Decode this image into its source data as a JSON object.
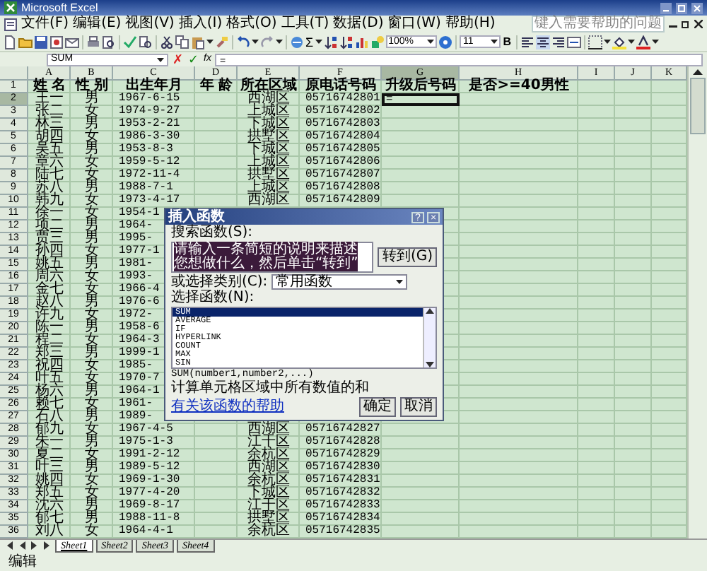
{
  "window": {
    "title": "Microsoft Excel"
  },
  "menu": [
    "文件(F)",
    "编辑(E)",
    "视图(V)",
    "插入(I)",
    "格式(O)",
    "工具(T)",
    "数据(D)",
    "窗口(W)",
    "帮助(H)"
  ],
  "help_box": {
    "placeholder": "键入需要帮助的问题"
  },
  "toolbar": {
    "sum": "Σ",
    "zoom": "100%",
    "font_size": "11",
    "bold": "B"
  },
  "formula_bar": {
    "name_box": "SUM",
    "cancel": "✗",
    "enter": "✓",
    "function": "fx",
    "content": "="
  },
  "columns": [
    {
      "label": "A",
      "selected": false
    },
    {
      "label": "B",
      "selected": false
    },
    {
      "label": "C",
      "selected": false
    },
    {
      "label": "D",
      "selected": false
    },
    {
      "label": "E",
      "selected": false
    },
    {
      "label": "F",
      "selected": false
    },
    {
      "label": "G",
      "selected": true
    },
    {
      "label": "H",
      "selected": false
    },
    {
      "label": "I",
      "selected": false
    },
    {
      "label": "J",
      "selected": false
    },
    {
      "label": "K",
      "selected": false
    }
  ],
  "header_row": {
    "number": "1",
    "name": "姓 名",
    "sex": "性 别",
    "birth": "出生年月",
    "age": "年 龄",
    "district": "所在区域",
    "phone": "原电话号码",
    "new_phone": "升级后号码",
    "male_over_40": "是否>=40男性"
  },
  "rows": [
    {
      "number": "2",
      "name": "王一",
      "sex": "男",
      "birth": "1967-6-15",
      "district": "西湖区",
      "phone": "05716742801",
      "new_phone": "=",
      "active": true
    },
    {
      "number": "3",
      "name": "张二",
      "sex": "女",
      "birth": "1974-9-27",
      "district": "上城区",
      "phone": "05716742802",
      "active": false
    },
    {
      "number": "4",
      "name": "林三",
      "sex": "男",
      "birth": "1953-2-21",
      "district": "下城区",
      "phone": "05716742803",
      "active": false
    },
    {
      "number": "5",
      "name": "胡四",
      "sex": "女",
      "birth": "1986-3-30",
      "district": "拱墅区",
      "phone": "05716742804",
      "active": false
    },
    {
      "number": "6",
      "name": "吴五",
      "sex": "男",
      "birth": "1953-8-3",
      "district": "下城区",
      "phone": "05716742805",
      "active": false
    },
    {
      "number": "7",
      "name": "章六",
      "sex": "女",
      "birth": "1959-5-12",
      "district": "上城区",
      "phone": "05716742806",
      "active": false
    },
    {
      "number": "8",
      "name": "陆七",
      "sex": "女",
      "birth": "1972-11-4",
      "district": "拱墅区",
      "phone": "05716742807",
      "active": false
    },
    {
      "number": "9",
      "name": "苏八",
      "sex": "男",
      "birth": "1988-7-1",
      "district": "上城区",
      "phone": "05716742808",
      "active": false
    },
    {
      "number": "10",
      "name": "韩九",
      "sex": "女",
      "birth": "1973-4-17",
      "district": "西湖区",
      "phone": "05716742809",
      "active": false
    },
    {
      "number": "11",
      "name": "徐一",
      "sex": "女",
      "birth": "1954-1",
      "active": false
    },
    {
      "number": "12",
      "name": "项二",
      "sex": "男",
      "birth": "1964-",
      "active": false
    },
    {
      "number": "13",
      "name": "贾三",
      "sex": "男",
      "birth": "1995-",
      "active": false
    },
    {
      "number": "14",
      "name": "孙四",
      "sex": "女",
      "birth": "1977-1",
      "active": false
    },
    {
      "number": "15",
      "name": "姚五",
      "sex": "男",
      "birth": "1981-",
      "active": false
    },
    {
      "number": "16",
      "name": "周六",
      "sex": "女",
      "birth": "1993-",
      "active": false
    },
    {
      "number": "17",
      "name": "金七",
      "sex": "女",
      "birth": "1966-4",
      "active": false
    },
    {
      "number": "18",
      "name": "赵八",
      "sex": "男",
      "birth": "1976-6",
      "active": false
    },
    {
      "number": "19",
      "name": "许九",
      "sex": "女",
      "birth": "1972-",
      "active": false
    },
    {
      "number": "20",
      "name": "陈一",
      "sex": "男",
      "birth": "1958-6",
      "active": false
    },
    {
      "number": "21",
      "name": "程二",
      "sex": "女",
      "birth": "1964-3",
      "active": false
    },
    {
      "number": "22",
      "name": "郑三",
      "sex": "男",
      "birth": "1999-1",
      "active": false
    },
    {
      "number": "23",
      "name": "祝四",
      "sex": "女",
      "birth": "1985-",
      "active": false
    },
    {
      "number": "24",
      "name": "叶五",
      "sex": "女",
      "birth": "1970-7",
      "active": false
    },
    {
      "number": "25",
      "name": "杨六",
      "sex": "男",
      "birth": "1964-1",
      "active": false
    },
    {
      "number": "26",
      "name": "赖七",
      "sex": "女",
      "birth": "1961-",
      "active": false
    },
    {
      "number": "27",
      "name": "石八",
      "sex": "男",
      "birth": "1989-",
      "active": false
    },
    {
      "number": "28",
      "name": "郁九",
      "sex": "女",
      "birth": "1967-4-5",
      "district": "西湖区",
      "phone": "05716742827",
      "active": false
    },
    {
      "number": "29",
      "name": "朱一",
      "sex": "男",
      "birth": "1975-1-3",
      "district": "江干区",
      "phone": "05716742828",
      "active": false
    },
    {
      "number": "30",
      "name": "夏二",
      "sex": "女",
      "birth": "1991-2-12",
      "district": "余杭区",
      "phone": "05716742829",
      "active": false
    },
    {
      "number": "31",
      "name": "叶三",
      "sex": "男",
      "birth": "1989-5-12",
      "district": "西湖区",
      "phone": "05716742830",
      "active": false
    },
    {
      "number": "32",
      "name": "姚四",
      "sex": "女",
      "birth": "1969-1-30",
      "district": "余杭区",
      "phone": "05716742831",
      "active": false
    },
    {
      "number": "33",
      "name": "郑五",
      "sex": "女",
      "birth": "1977-4-20",
      "district": "下城区",
      "phone": "05716742832",
      "active": false
    },
    {
      "number": "34",
      "name": "沈六",
      "sex": "男",
      "birth": "1969-8-17",
      "district": "江干区",
      "phone": "05716742833",
      "active": false
    },
    {
      "number": "35",
      "name": "郁七",
      "sex": "男",
      "birth": "1988-11-8",
      "district": "拱墅区",
      "phone": "05716742834",
      "active": false
    },
    {
      "number": "36",
      "name": "刘八",
      "sex": "女",
      "birth": "1964-4-1",
      "district": "余杭区",
      "phone": "05716742835",
      "active": false
    }
  ],
  "dialog": {
    "title": "插入函数",
    "help": "?",
    "close": "×",
    "search_label": "搜索函数(S):",
    "search_value": "请输入一条简短的说明来描述您想做什么，然后单击“转到”",
    "value_selected": true,
    "go_button": "转到(G)",
    "category_label": "或选择类别(C):",
    "category": "常用函数",
    "list_label": "选择函数(N):",
    "functions": [
      {
        "name": "SUM",
        "selected": true
      },
      {
        "name": "AVERAGE",
        "selected": false
      },
      {
        "name": "IF",
        "selected": false
      },
      {
        "name": "HYPERLINK",
        "selected": false
      },
      {
        "name": "COUNT",
        "selected": false
      },
      {
        "name": "MAX",
        "selected": false
      },
      {
        "name": "SIN",
        "selected": false
      }
    ],
    "signature": "SUM(number1,number2,...)",
    "description": "计算单元格区域中所有数值的和",
    "help_link": "有关该函数的帮助",
    "ok": "确定",
    "cancel": "取消"
  },
  "sheet_tabs": [
    {
      "label": "Sheet1",
      "selected": true
    },
    {
      "label": "Sheet2",
      "selected": false
    },
    {
      "label": "Sheet3",
      "selected": false
    },
    {
      "label": "Sheet4",
      "selected": false
    }
  ],
  "status_bar": {
    "mode": "编辑"
  }
}
